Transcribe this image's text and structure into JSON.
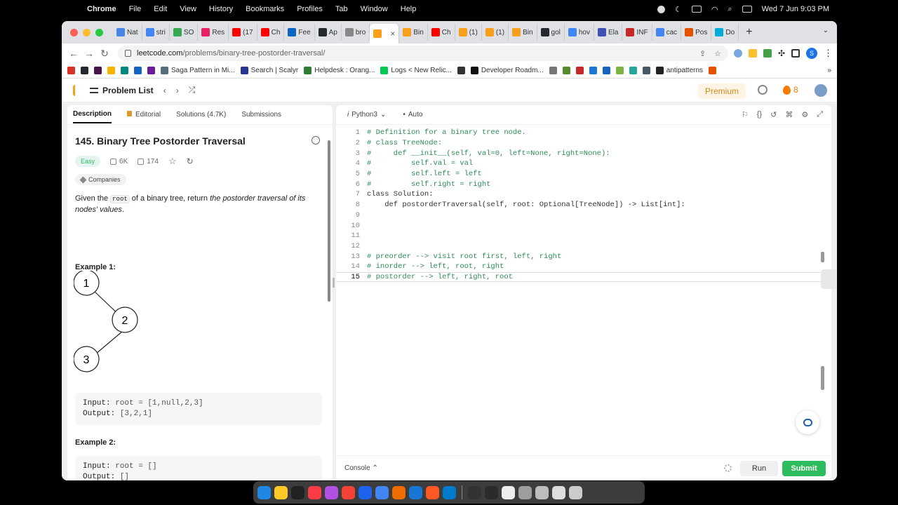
{
  "menubar": {
    "app": "Chrome",
    "items": [
      "File",
      "Edit",
      "View",
      "History",
      "Bookmarks",
      "Profiles",
      "Tab",
      "Window",
      "Help"
    ],
    "clock": "Wed 7 Jun  9:03 PM"
  },
  "tabs": [
    {
      "label": "Nat",
      "color": "#4a86e8"
    },
    {
      "label": "stri",
      "color": "#4285f4"
    },
    {
      "label": "SO",
      "color": "#34a853"
    },
    {
      "label": "Res",
      "color": "#e91e63"
    },
    {
      "label": "(17",
      "color": "#ff0000"
    },
    {
      "label": "Ch",
      "color": "#ff0000"
    },
    {
      "label": "Fee",
      "color": "#0a66c2"
    },
    {
      "label": "Ap",
      "color": "#24292f"
    },
    {
      "label": "bro",
      "color": "#888888"
    },
    {
      "label": "",
      "color": "#f89f1b",
      "active": true
    },
    {
      "label": "Bin",
      "color": "#f89f1b"
    },
    {
      "label": "Ch",
      "color": "#ff0000"
    },
    {
      "label": "(1)",
      "color": "#f89f1b"
    },
    {
      "label": "(1)",
      "color": "#f89f1b"
    },
    {
      "label": "Bin",
      "color": "#f89f1b"
    },
    {
      "label": "gol",
      "color": "#24292f"
    },
    {
      "label": "hov",
      "color": "#4285f4"
    },
    {
      "label": "Ela",
      "color": "#3f51b5"
    },
    {
      "label": "INF",
      "color": "#c62828"
    },
    {
      "label": "cac",
      "color": "#4285f4"
    },
    {
      "label": "Pos",
      "color": "#e65100"
    },
    {
      "label": "Do",
      "color": "#00add8"
    }
  ],
  "address": {
    "host": "leetcode.com",
    "path": "/problems/binary-tree-postorder-traversal/",
    "profile_initial": "S"
  },
  "bookmarks": [
    {
      "label": "",
      "color": "#d93025"
    },
    {
      "label": "",
      "color": "#24292f"
    },
    {
      "label": "",
      "color": "#4a154b"
    },
    {
      "label": "",
      "color": "#f4b400"
    },
    {
      "label": "",
      "color": "#00897b"
    },
    {
      "label": "",
      "color": "#1565c0"
    },
    {
      "label": "",
      "color": "#6a1b9a"
    },
    {
      "label": "Saga Pattern in Mi...",
      "color": "#546e7a"
    },
    {
      "label": "Search | Scalyr",
      "color": "#283593"
    },
    {
      "label": "Helpdesk : Orang...",
      "color": "#2e7d32"
    },
    {
      "label": "Logs < New Relic...",
      "color": "#00c853"
    },
    {
      "label": "",
      "color": "#333333"
    },
    {
      "label": "Developer Roadm...",
      "color": "#111111"
    },
    {
      "label": "",
      "color": "#777777"
    },
    {
      "label": "",
      "color": "#558b2f"
    },
    {
      "label": "",
      "color": "#c62828"
    },
    {
      "label": "",
      "color": "#1976d2"
    },
    {
      "label": "",
      "color": "#1565c0"
    },
    {
      "label": "",
      "color": "#7cb342"
    },
    {
      "label": "",
      "color": "#26a69a"
    },
    {
      "label": "",
      "color": "#455a64"
    },
    {
      "label": "antipatterns",
      "color": "#222222"
    },
    {
      "label": "",
      "color": "#e65100"
    }
  ],
  "lc": {
    "problem_list": "Problem List",
    "premium": "Premium",
    "streak": "8",
    "tabs": [
      "Description",
      "Editorial",
      "Solutions (4.7K)",
      "Submissions"
    ],
    "title": "145. Binary Tree Postorder Traversal",
    "difficulty": "Easy",
    "likes": "6K",
    "dislikes": "174",
    "companies": "Companies",
    "desc_pre": "Given the ",
    "desc_code": "root",
    "desc_mid": " of a binary tree, return ",
    "desc_em": "the postorder traversal of its nodes' values",
    "desc_end": ".",
    "example1": "Example 1:",
    "tree_nodes": [
      "1",
      "2",
      "3"
    ],
    "ex1_input_label": "Input:",
    "ex1_input": " root = [1,null,2,3]",
    "ex1_output_label": "Output:",
    "ex1_output": " [3,2,1]",
    "example2": "Example 2:",
    "ex2_input_label": "Input:",
    "ex2_input": " root = []",
    "ex2_output_label": "Output:",
    "ex2_output": " []",
    "language": "Python3",
    "auto": "Auto",
    "console": "Console",
    "run": "Run",
    "submit": "Submit"
  },
  "code_lines": [
    {
      "n": "1",
      "text": "# Definition for a binary tree node."
    },
    {
      "n": "2",
      "text": "# class TreeNode:"
    },
    {
      "n": "3",
      "text": "#     def __init__(self, val=0, left=None, right=None):"
    },
    {
      "n": "4",
      "text": "#         self.val = val"
    },
    {
      "n": "5",
      "text": "#         self.left = left"
    },
    {
      "n": "6",
      "text": "#         self.right = right"
    },
    {
      "n": "7",
      "text": "class Solution:"
    },
    {
      "n": "8",
      "text": "    def postorderTraversal(self, root: Optional[TreeNode]) -> List[int]:"
    },
    {
      "n": "9",
      "text": ""
    },
    {
      "n": "10",
      "text": ""
    },
    {
      "n": "11",
      "text": ""
    },
    {
      "n": "12",
      "text": ""
    },
    {
      "n": "13",
      "text": "# preorder --> visit root first, left, right"
    },
    {
      "n": "14",
      "text": "# inorder --> left, root, right"
    },
    {
      "n": "15",
      "text": "# postorder --> left, right, root"
    }
  ],
  "dock_colors": [
    "#1e88e5",
    "#ffca28",
    "#222222",
    "#fc3c44",
    "#b150e2",
    "#f44336",
    "#1d63ed",
    "#4285f4",
    "#ef6c00",
    "#1976d2",
    "#ff5722",
    "#007acc",
    "#333333",
    "#2b2b2b",
    "#eeeeee",
    "#9e9e9e",
    "#bdbdbd",
    "#dddddd",
    "#cccccc"
  ]
}
